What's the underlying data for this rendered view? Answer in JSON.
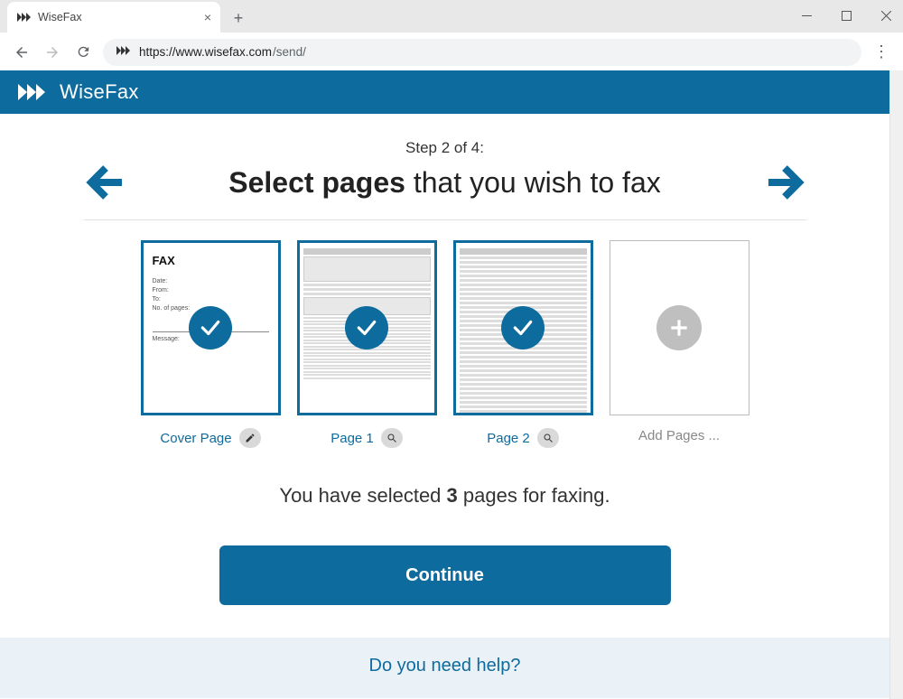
{
  "window": {
    "tab_title": "WiseFax",
    "url_scheme_host": "https://www.wisefax.com",
    "url_path": "/send/"
  },
  "brand": {
    "name": "WiseFax",
    "color": "#0d6b9e"
  },
  "wizard": {
    "step_label": "Step 2 of 4:",
    "title_bold": "Select pages",
    "title_rest": " that you wish to fax"
  },
  "pages": [
    {
      "label": "Cover Page",
      "kind": "cover",
      "selected": true,
      "action_icon": "pencil"
    },
    {
      "label": "Page 1",
      "kind": "form",
      "selected": true,
      "action_icon": "magnifier"
    },
    {
      "label": "Page 2",
      "kind": "form",
      "selected": true,
      "action_icon": "magnifier"
    },
    {
      "label": "Add Pages ...",
      "kind": "add",
      "selected": false,
      "action_icon": null
    }
  ],
  "cover_preview": {
    "heading": "FAX",
    "fields": [
      "Date:",
      "From:",
      "To:",
      "No. of pages:",
      "Message:"
    ]
  },
  "summary": {
    "prefix": "You have selected ",
    "count": "3",
    "suffix": " pages for faxing."
  },
  "buttons": {
    "continue": "Continue"
  },
  "help": {
    "text": "Do you need help?"
  }
}
